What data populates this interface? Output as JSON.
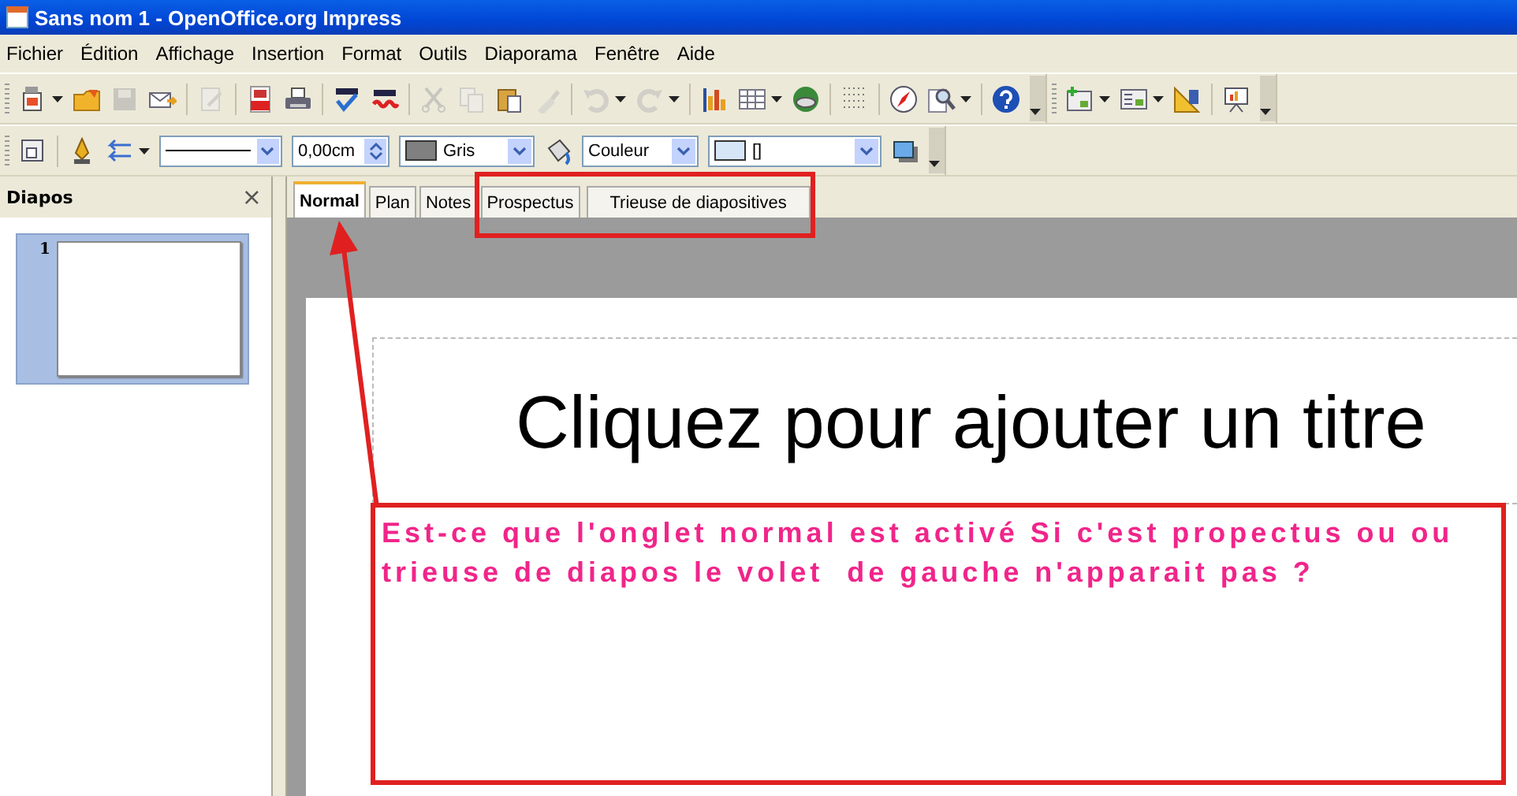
{
  "window": {
    "title": "Sans nom 1 - OpenOffice.org Impress"
  },
  "menu": [
    "Fichier",
    "Édition",
    "Affichage",
    "Insertion",
    "Format",
    "Outils",
    "Diaporama",
    "Fenêtre",
    "Aide"
  ],
  "standard_toolbar": [
    {
      "kind": "new",
      "disabled": false,
      "dropdown": true
    },
    {
      "kind": "open",
      "disabled": false
    },
    {
      "kind": "save",
      "disabled": true
    },
    {
      "kind": "mail",
      "disabled": false
    },
    {
      "kind": "sep"
    },
    {
      "kind": "edit",
      "disabled": true
    },
    {
      "kind": "sep"
    },
    {
      "kind": "pdf",
      "disabled": false
    },
    {
      "kind": "print",
      "disabled": false
    },
    {
      "kind": "sep"
    },
    {
      "kind": "spell",
      "disabled": false
    },
    {
      "kind": "autospell",
      "disabled": false
    },
    {
      "kind": "sep"
    },
    {
      "kind": "cut",
      "disabled": true
    },
    {
      "kind": "copy",
      "disabled": true
    },
    {
      "kind": "paste",
      "disabled": false
    },
    {
      "kind": "brush",
      "disabled": true
    },
    {
      "kind": "sep"
    },
    {
      "kind": "undo",
      "disabled": true,
      "dropdown": true
    },
    {
      "kind": "redo",
      "disabled": true,
      "dropdown": true
    },
    {
      "kind": "sep"
    },
    {
      "kind": "chart",
      "disabled": false
    },
    {
      "kind": "table",
      "disabled": false,
      "dropdown": true
    },
    {
      "kind": "globe",
      "disabled": false
    },
    {
      "kind": "sep"
    },
    {
      "kind": "grid",
      "disabled": false
    },
    {
      "kind": "sep"
    },
    {
      "kind": "compass",
      "disabled": false
    },
    {
      "kind": "zoom",
      "disabled": false,
      "dropdown": true
    },
    {
      "kind": "sep"
    },
    {
      "kind": "help",
      "disabled": false
    },
    {
      "kind": "more"
    }
  ],
  "presentation_toolbar": [
    {
      "kind": "slide",
      "disabled": false,
      "dropdown": true
    },
    {
      "kind": "layout",
      "disabled": false,
      "dropdown": true
    },
    {
      "kind": "design",
      "disabled": false
    },
    {
      "kind": "sep"
    },
    {
      "kind": "show",
      "disabled": false
    },
    {
      "kind": "more"
    }
  ],
  "line_toolbar": {
    "line_width": "0,00cm",
    "line_color": "Gris",
    "area_style": "Couleur",
    "area_fill": "[]"
  },
  "sidebar": {
    "title": "Diapos",
    "close": "×",
    "slides": [
      {
        "number": "1",
        "selected": true
      }
    ]
  },
  "tabs": [
    {
      "label": "Normal",
      "selected": true
    },
    {
      "label": "Plan",
      "selected": false
    },
    {
      "label": "Notes",
      "selected": false
    },
    {
      "label": "Prospectus",
      "selected": false
    },
    {
      "label": "Trieuse de diapositives",
      "selected": false
    }
  ],
  "slide": {
    "title_placeholder": "Cliquez pour ajouter un titre"
  },
  "annotation": {
    "text": "Est-ce que l'onglet normal est activé Si c'est propectus ou ou trieuse de diapos le volet  de gauche n'apparait pas ?"
  }
}
